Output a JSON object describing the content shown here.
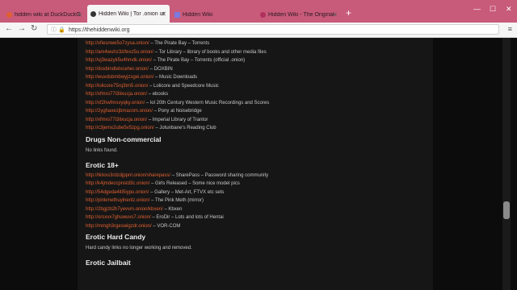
{
  "tabs": [
    {
      "title": "hidden wiki at DuckDuckGo",
      "favicon_color": "#e06030"
    },
    {
      "title": "Hidden Wiki | Tor .onion urls",
      "favicon_color": "#333333"
    },
    {
      "title": "Hidden Wiki",
      "favicon_color": "#7a7ae0"
    },
    {
      "title": "Hidden Wiki - The Original (",
      "favicon_color": "#b03060"
    }
  ],
  "nav": {
    "url": "https://thehiddenwiki.org"
  },
  "sections": {
    "top_links": [
      {
        "url": "http://xfiesnwe5o7zysa.onion/",
        "desc": " – The Pirate Bay – Torrents"
      },
      {
        "url": "http://am4wuhz3zifexz5u.onion/",
        "desc": " – Tor Library – library of books and other media files"
      },
      {
        "url": "http://uj3wazyk5u4hnvtk.onion/",
        "desc": " – The Pirate Bay – Torrents (official .onion)"
      },
      {
        "url": "http://doxbindtelxceher.onion/",
        "desc": " – DOXBIN"
      },
      {
        "url": "http://wuvdsbmbwyjzsgei.onion/",
        "desc": " – Music Downloads"
      },
      {
        "url": "http://lolicore75rq3tm5.onion/",
        "desc": " – Lolicore and Speedcore Music"
      },
      {
        "url": "http://xfmro77i3lixucja.onion/",
        "desc": " – ebooks"
      },
      {
        "url": "http://xf2hwfmsvyqky.onion/",
        "desc": " – lol 20th Century Western Music Recordings and Scores"
      },
      {
        "url": "http://2yghaxezjbmacnm.onion/",
        "desc": " – Pony at Noisebridge"
      },
      {
        "url": "http://xfmro77i3lixucja.onion/",
        "desc": " – Imperial Library of Trantor"
      },
      {
        "url": "http://c3jemx2ube5v5zpg.onion/",
        "desc": " – Jotunbane's Reading Club"
      }
    ],
    "drugs": {
      "heading": "Drugs Non-commercial",
      "note": "No links found."
    },
    "erotic": {
      "heading": "Erotic 18+",
      "links": [
        {
          "url": "http://tklxxs3rdzdjppnl.onion/sharepass/",
          "desc": " – SharePass – Password sharing community"
        },
        {
          "url": "http://k4jmdeccpnstd3c.onion/",
          "desc": " – Girls Released – Some nice model pics"
        },
        {
          "url": "http://54dgeda4iti5iypu.onion/",
          "desc": " – Gallery – Met-Art, FTVX etc sets"
        },
        {
          "url": "http://pinkmethuylnenlz.onion/",
          "desc": " – The Pink Meth (mirror)"
        },
        {
          "url": "http://2bgjzb2h7yevvm.onion/kbxen/",
          "desc": " – Kbxen"
        },
        {
          "url": "http://orsxvx7ghuwuvs7.onion/",
          "desc": " – EroDir – Lots and lots of Hentai"
        },
        {
          "url": "http://mmgh3rgeswigzdr.onion/",
          "desc": " – VOR-COM"
        }
      ]
    },
    "hard_candy": {
      "heading": "Erotic Hard Candy",
      "note": "Hard candy links no longer working and removed."
    },
    "jailbait": {
      "heading": "Erotic Jailbait"
    }
  }
}
